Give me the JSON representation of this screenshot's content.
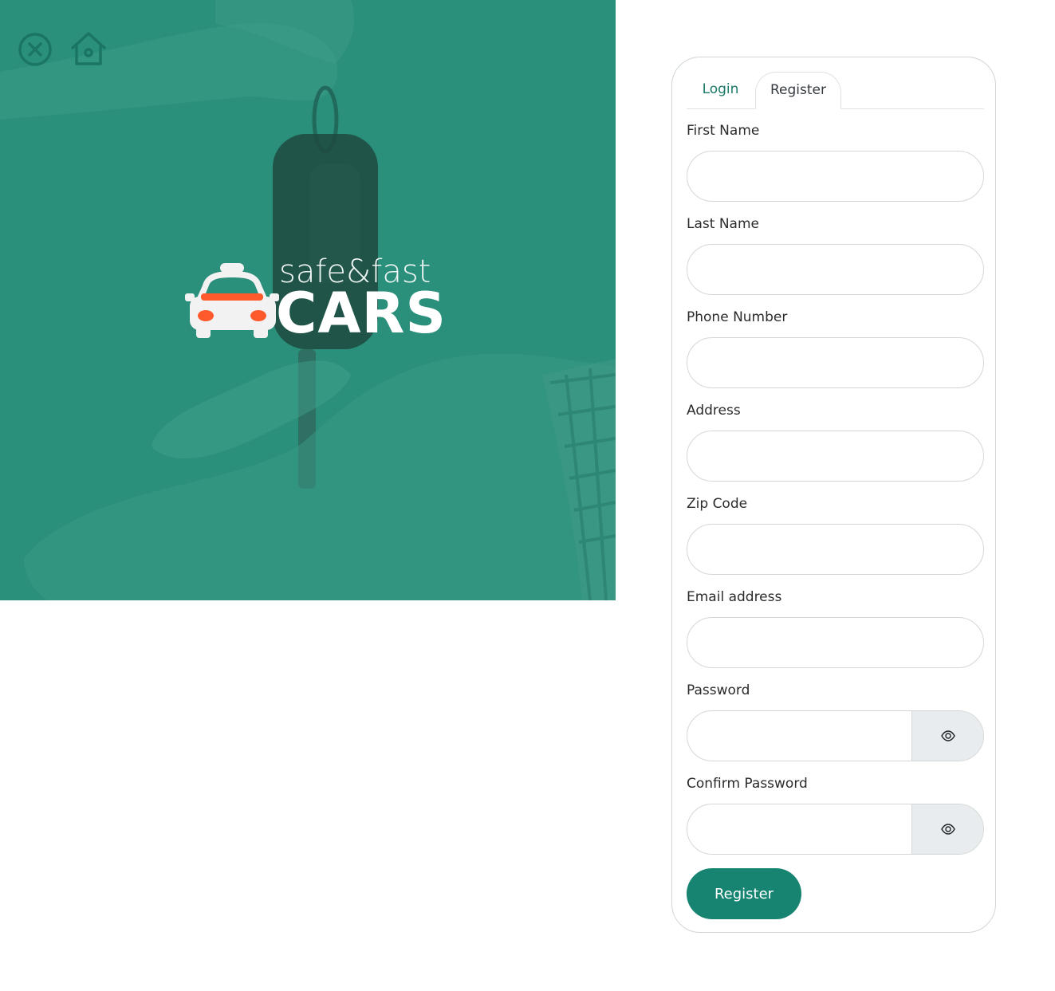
{
  "brand": {
    "tagline": "safe&fast",
    "name": "CARS"
  },
  "nav": {
    "close_icon": "close-circle-icon",
    "home_icon": "home-icon"
  },
  "tabs": [
    {
      "label": "Login",
      "active": false
    },
    {
      "label": "Register",
      "active": true
    }
  ],
  "form": {
    "first_name": {
      "label": "First Name",
      "value": ""
    },
    "last_name": {
      "label": "Last Name",
      "value": ""
    },
    "phone": {
      "label": "Phone Number",
      "value": ""
    },
    "address": {
      "label": "Address",
      "value": ""
    },
    "zip": {
      "label": "Zip Code",
      "value": ""
    },
    "email": {
      "label": "Email address",
      "value": ""
    },
    "password": {
      "label": "Password",
      "value": "",
      "toggle_icon": "eye-icon"
    },
    "confirm_password": {
      "label": "Confirm Password",
      "value": "",
      "toggle_icon": "eye-icon"
    },
    "submit_label": "Register"
  },
  "colors": {
    "hero_bg": "#2b907b",
    "accent": "#168470",
    "tab_active_text": "#1a7a68",
    "logo_stripe": "#ff5a2c"
  }
}
